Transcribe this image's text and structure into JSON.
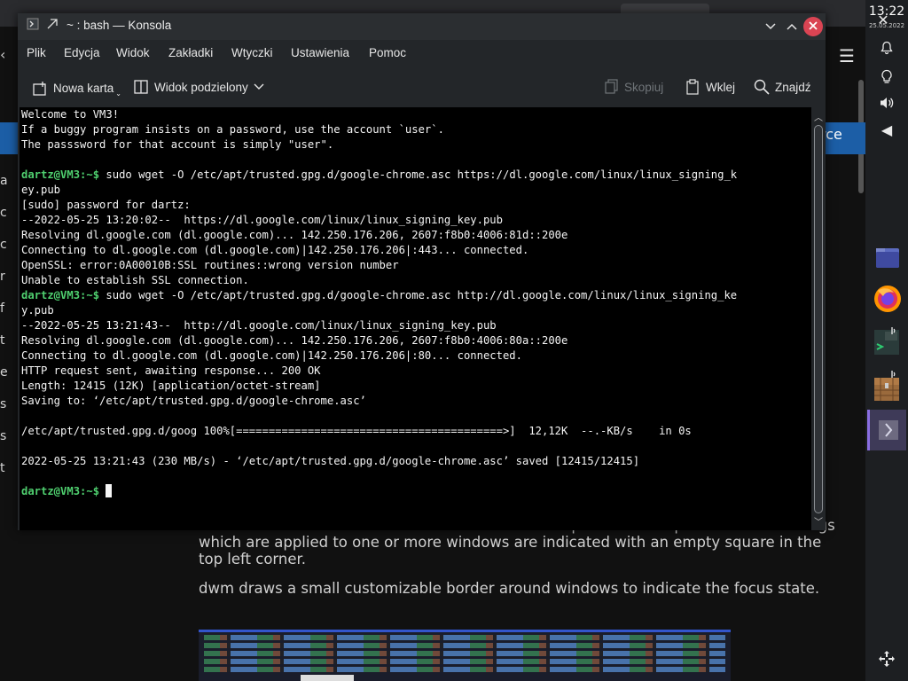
{
  "background_page": {
    "blue_bar_right": "rce",
    "left_letters": [
      "a",
      "c",
      "c",
      "r",
      "f",
      "t",
      "e",
      "s",
      "s",
      "t"
    ],
    "paragraphs": [
      "of the focused window are indicated with a filled square in the top left corner. The tags which are applied to one or more windows are indicated with an empty square in the top left corner.",
      "dwm draws a small customizable border around windows to indicate the focus state."
    ]
  },
  "panel": {
    "time": "13:22",
    "date": "25.05.2022",
    "icons": [
      "close-icon",
      "bell-icon",
      "lightbulb-icon",
      "speaker-icon",
      "arrow-left-icon",
      "move-icon"
    ],
    "tasks": [
      "folder-icon",
      "firefox-icon",
      "konsole-icon",
      "minecraft-chest-icon",
      "arrow-right-icon"
    ]
  },
  "window": {
    "title": "~ : bash — Konsola",
    "menu": [
      "Plik",
      "Edycja",
      "Widok",
      "Zakładki",
      "Wtyczki",
      "Ustawienia",
      "Pomoc"
    ],
    "toolbar": {
      "new_tab": "Nowa karta",
      "split_view": "Widok podzielony",
      "copy": "Skopiuj",
      "paste": "Wklej",
      "find": "Znajdź"
    }
  },
  "terminal": {
    "lines": [
      {
        "text": "Welcome to VM3!"
      },
      {
        "text": "If a buggy program insists on a password, use the account `user`."
      },
      {
        "text": "The passsword for that account is simply \"user\"."
      },
      {
        "text": ""
      },
      {
        "prompt": "dartz@VM3",
        "path": ":~$",
        "text": " sudo wget -O /etc/apt/trusted.gpg.d/google-chrome.asc https://dl.google.com/linux/linux_signing_k"
      },
      {
        "text": "ey.pub"
      },
      {
        "text": "[sudo] password for dartz:"
      },
      {
        "text": "--2022-05-25 13:20:02--  https://dl.google.com/linux/linux_signing_key.pub"
      },
      {
        "text": "Resolving dl.google.com (dl.google.com)... 142.250.176.206, 2607:f8b0:4006:81d::200e"
      },
      {
        "text": "Connecting to dl.google.com (dl.google.com)|142.250.176.206|:443... connected."
      },
      {
        "text": "OpenSSL: error:0A00010B:SSL routines::wrong version number"
      },
      {
        "text": "Unable to establish SSL connection."
      },
      {
        "prompt": "dartz@VM3",
        "path": ":~$",
        "text": " sudo wget -O /etc/apt/trusted.gpg.d/google-chrome.asc http://dl.google.com/linux/linux_signing_ke"
      },
      {
        "text": "y.pub"
      },
      {
        "text": "--2022-05-25 13:21:43--  http://dl.google.com/linux/linux_signing_key.pub"
      },
      {
        "text": "Resolving dl.google.com (dl.google.com)... 142.250.176.206, 2607:f8b0:4006:80a::200e"
      },
      {
        "text": "Connecting to dl.google.com (dl.google.com)|142.250.176.206|:80... connected."
      },
      {
        "text": "HTTP request sent, awaiting response... 200 OK"
      },
      {
        "text": "Length: 12415 (12K) [application/octet-stream]"
      },
      {
        "text": "Saving to: ‘/etc/apt/trusted.gpg.d/google-chrome.asc’"
      },
      {
        "text": ""
      },
      {
        "text": "/etc/apt/trusted.gpg.d/goog 100%[=========================================>]  12,12K  --.-KB/s    in 0s"
      },
      {
        "text": ""
      },
      {
        "text": "2022-05-25 13:21:43 (230 MB/s) - ‘/etc/apt/trusted.gpg.d/google-chrome.asc’ saved [12415/12415]"
      },
      {
        "text": ""
      },
      {
        "prompt": "dartz@VM3",
        "path": ":~$",
        "text": " ",
        "cursor": true
      }
    ]
  },
  "colors": {
    "prompt": "#4fcf6f",
    "window_bg": "#232629",
    "close_button": "#da4453",
    "accent_blue": "#1c5ea6"
  }
}
